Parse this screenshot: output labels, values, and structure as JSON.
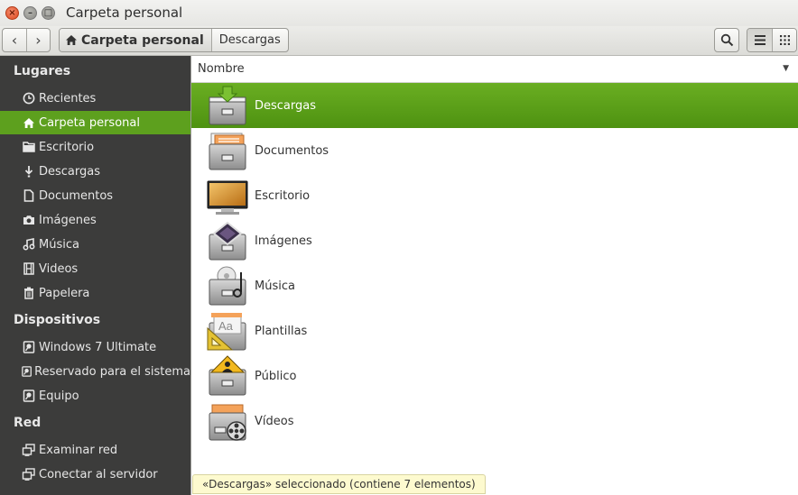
{
  "window": {
    "title": "Carpeta personal"
  },
  "toolbar": {
    "back": "‹",
    "forward": "›",
    "crumbs": [
      "Carpeta personal",
      "Descargas"
    ],
    "search_icon": "search-icon",
    "view_list_icon": "list-view-icon",
    "view_grid_icon": "grid-view-icon"
  },
  "sidebar": {
    "sections": [
      {
        "title": "Lugares",
        "items": [
          {
            "label": "Recientes",
            "icon": "clock-icon"
          },
          {
            "label": "Carpeta personal",
            "icon": "home-icon",
            "selected": true
          },
          {
            "label": "Escritorio",
            "icon": "folder-icon"
          },
          {
            "label": "Descargas",
            "icon": "download-icon"
          },
          {
            "label": "Documentos",
            "icon": "document-icon"
          },
          {
            "label": "Imágenes",
            "icon": "camera-icon"
          },
          {
            "label": "Música",
            "icon": "music-icon"
          },
          {
            "label": "Videos",
            "icon": "film-icon"
          },
          {
            "label": "Papelera",
            "icon": "trash-icon"
          }
        ]
      },
      {
        "title": "Dispositivos",
        "items": [
          {
            "label": "Windows 7 Ultimate",
            "icon": "drive-icon"
          },
          {
            "label": "Reservado para el sistema",
            "icon": "drive-icon"
          },
          {
            "label": "Equipo",
            "icon": "drive-icon"
          }
        ]
      },
      {
        "title": "Red",
        "items": [
          {
            "label": "Examinar red",
            "icon": "network-icon"
          },
          {
            "label": "Conectar al servidor",
            "icon": "network-icon"
          }
        ]
      }
    ]
  },
  "main": {
    "column_header": "Nombre",
    "files": [
      {
        "name": "Descargas",
        "icon": "download-folder-icon",
        "selected": true
      },
      {
        "name": "Documentos",
        "icon": "documents-folder-icon"
      },
      {
        "name": "Escritorio",
        "icon": "desktop-folder-icon"
      },
      {
        "name": "Imágenes",
        "icon": "pictures-folder-icon"
      },
      {
        "name": "Música",
        "icon": "music-folder-icon"
      },
      {
        "name": "Plantillas",
        "icon": "templates-folder-icon"
      },
      {
        "name": "Público",
        "icon": "public-folder-icon"
      },
      {
        "name": "Vídeos",
        "icon": "videos-folder-icon"
      }
    ]
  },
  "status": {
    "text": "«Descargas» seleccionado  (contiene 7 elementos)"
  },
  "colors": {
    "accent": "#5da01e",
    "sidebar_bg": "#3c3c3b",
    "status_bg": "#fdfacf"
  }
}
